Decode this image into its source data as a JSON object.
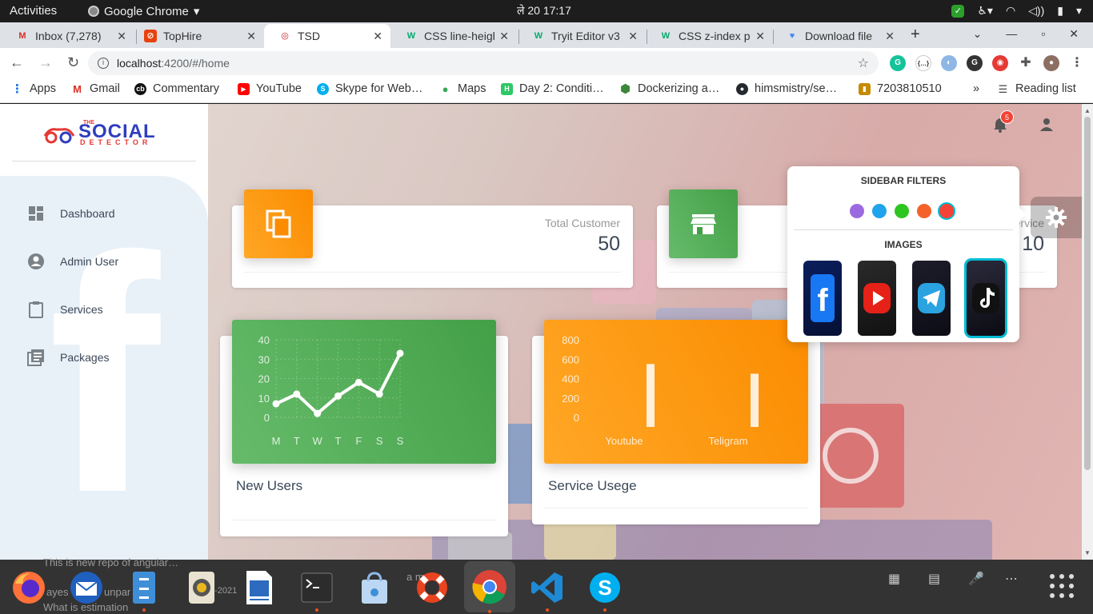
{
  "topbar": {
    "activities": "Activities",
    "app": "Google Chrome",
    "clock": "ले 20  17:17"
  },
  "tabs": [
    {
      "title": "Inbox (7,278)",
      "icon": "gmail-icon",
      "color": "#d93025",
      "glyph": "M"
    },
    {
      "title": "TopHire",
      "icon": "tophire-icon",
      "color": "#e8410c",
      "glyph": "⊘"
    },
    {
      "title": "TSD",
      "icon": "tsd-icon",
      "color": "#c62828",
      "glyph": "◎",
      "active": true
    },
    {
      "title": "CSS line-heigh",
      "icon": "w3schools-icon",
      "color": "#04aa6d",
      "glyph": "W"
    },
    {
      "title": "Tryit Editor v3",
      "icon": "w3schools-icon",
      "color": "#04aa6d",
      "glyph": "W"
    },
    {
      "title": "CSS z-index pr",
      "icon": "w3schools-icon",
      "color": "#04aa6d",
      "glyph": "W"
    },
    {
      "title": "Download file",
      "icon": "download-icon",
      "color": "#4285f4",
      "glyph": "♥"
    }
  ],
  "address": {
    "host": "localhost",
    "path": ":4200/#/home"
  },
  "bookmarks": [
    {
      "label": "Apps",
      "icon": "apps-grid-icon",
      "color": "#1a73e8",
      "glyph": "⋮"
    },
    {
      "label": "Gmail",
      "icon": "gmail-icon",
      "color": "#d93025",
      "glyph": "M"
    },
    {
      "label": "Commentary",
      "icon": "commentary-icon",
      "color": "#111",
      "glyph": "cb"
    },
    {
      "label": "YouTube",
      "icon": "youtube-icon",
      "color": "#ff0000",
      "glyph": "▶"
    },
    {
      "label": "Skype for Web…",
      "icon": "skype-icon",
      "color": "#00aff0",
      "glyph": "S"
    },
    {
      "label": "Maps",
      "icon": "maps-icon",
      "color": "#34a853",
      "glyph": "●"
    },
    {
      "label": "Day 2: Conditi…",
      "icon": "hackerrank-icon",
      "color": "#2ec866",
      "glyph": "H"
    },
    {
      "label": "Dockerizing a…",
      "icon": "node-icon",
      "color": "#3c873a",
      "glyph": "⬢"
    },
    {
      "label": "himsmistry/se…",
      "icon": "github-icon",
      "color": "#24292e",
      "glyph": "●"
    },
    {
      "label": "7203810510",
      "icon": "bookmark-page-icon",
      "color": "#c58a00",
      "glyph": "▮"
    }
  ],
  "bookmarks_more": "»",
  "reading_list": "Reading list",
  "logo": {
    "the": "THE",
    "social": "SOCIAL",
    "detector": "DETECTOR"
  },
  "sidebar": {
    "items": [
      {
        "label": "Dashboard",
        "icon": "dashboard-icon"
      },
      {
        "label": "Admin User",
        "icon": "person-icon"
      },
      {
        "label": "Services",
        "icon": "clipboard-icon"
      },
      {
        "label": "Packages",
        "icon": "library-icon"
      }
    ]
  },
  "header": {
    "notification_count": "5"
  },
  "stats": [
    {
      "category": "Total Customer",
      "value": "50",
      "icon": "copy-icon",
      "color": "#fb8c00"
    },
    {
      "category": "Total Service",
      "value": "10",
      "icon": "store-icon",
      "color": "#43a047"
    }
  ],
  "cards": [
    {
      "title": "New Users",
      "color": "#4caf50"
    },
    {
      "title": "Service Usege",
      "color": "#ff9800"
    }
  ],
  "chart_data": [
    {
      "type": "line",
      "title": "New Users",
      "categories": [
        "M",
        "T",
        "W",
        "T",
        "F",
        "S",
        "S"
      ],
      "values": [
        7,
        12,
        2,
        11,
        18,
        12,
        33
      ],
      "y_ticks": [
        "0",
        "10",
        "20",
        "30",
        "40"
      ],
      "ylim": [
        0,
        40
      ],
      "grid": true
    },
    {
      "type": "bar",
      "title": "Service Usege",
      "categories": [
        "Youtube",
        "Teligram"
      ],
      "values": [
        550,
        450
      ],
      "y_ticks": [
        "0",
        "200",
        "400",
        "600",
        "800"
      ],
      "ylim": [
        0,
        800
      ],
      "grid": false
    }
  ],
  "settings": {
    "sidebar_filters": "SIDEBAR FILTERS",
    "images": "IMAGES",
    "colors": [
      "#9c6ae0",
      "#1fa3ec",
      "#2ec520",
      "#f4622a",
      "#f44336"
    ],
    "selected_color": 4,
    "images_list": [
      "facebook-icon",
      "youtube-icon",
      "telegram-icon",
      "tiktok-icon"
    ],
    "selected_image": 3
  },
  "dock": {
    "ghost_line1": "This is new repo of angular…",
    "ghost_line2a": "ayes",
    "ghost_line2b": "unpar",
    "ghost_line2c": "4-2021",
    "ghost_line3": "What is estimation",
    "ghost_mid": "a m"
  }
}
